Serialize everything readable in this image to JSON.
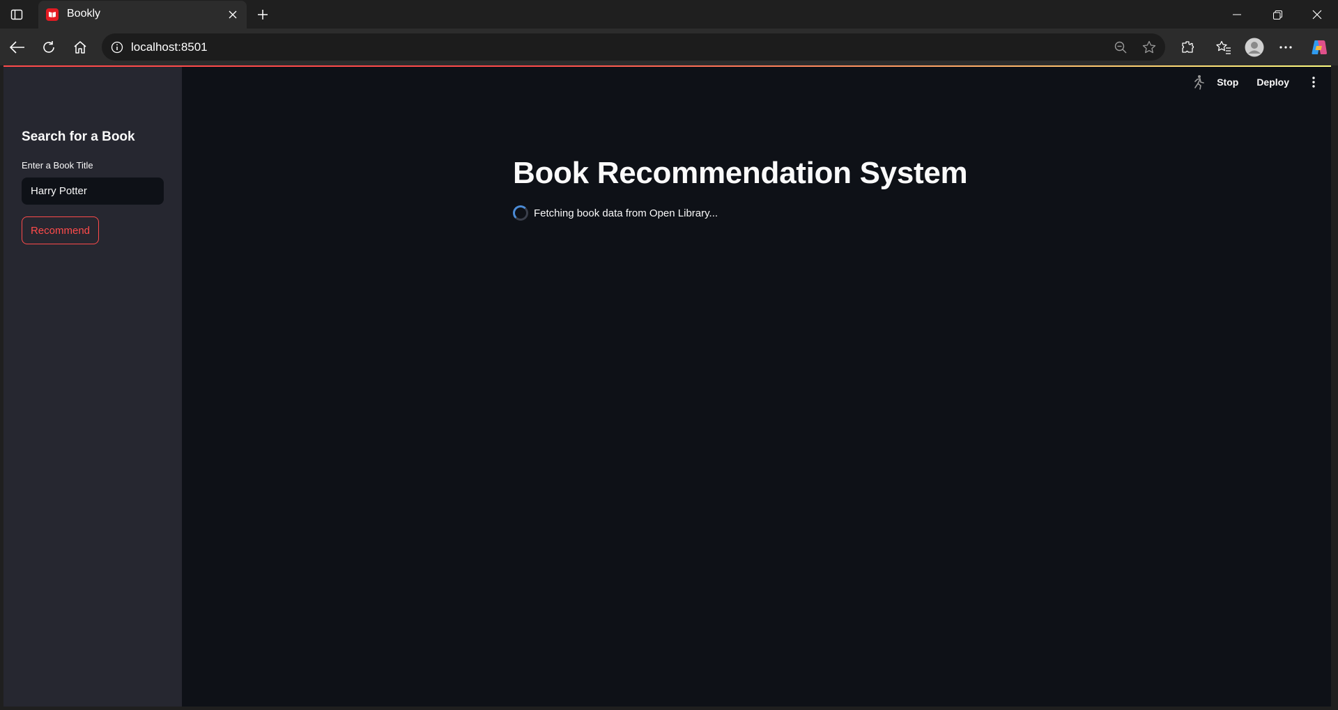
{
  "browser": {
    "tab": {
      "title": "Bookly",
      "favicon": "book-icon"
    },
    "address_bar": {
      "url": "localhost:8501"
    }
  },
  "colors": {
    "accent": "#ff4b4b",
    "page_background": "#0e1117",
    "sidebar_background": "#262730",
    "spinner": "#4b8bd6"
  },
  "app_header": {
    "stop_label": "Stop",
    "deploy_label": "Deploy"
  },
  "sidebar": {
    "heading": "Search for a Book",
    "input_label": "Enter a Book Title",
    "input_value": "Harry Potter",
    "button_label": "Recommend"
  },
  "main": {
    "title": "Book Recommendation System",
    "status_text": "Fetching book data from Open Library..."
  }
}
